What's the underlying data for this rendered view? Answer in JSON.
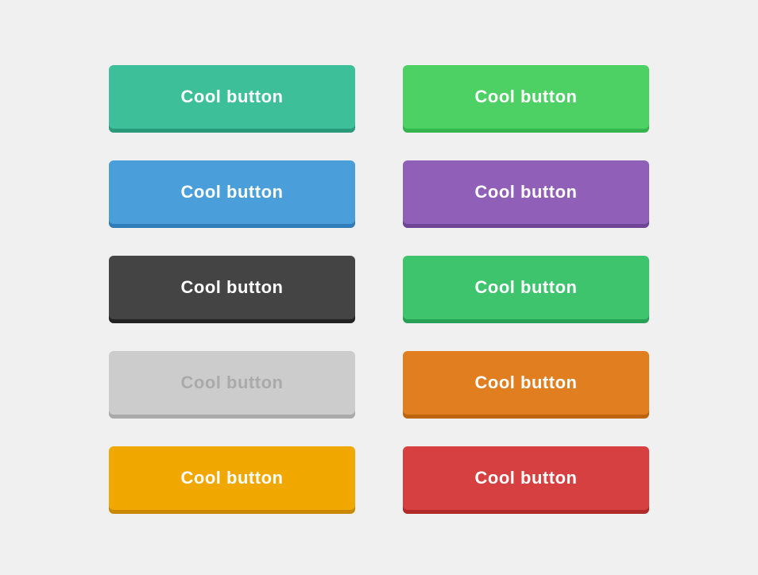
{
  "buttons": [
    {
      "id": "btn-1",
      "label": "Cool button",
      "class": "btn-teal",
      "name": "teal-button"
    },
    {
      "id": "btn-2",
      "label": "Cool button",
      "class": "btn-green",
      "name": "green-button"
    },
    {
      "id": "btn-3",
      "label": "Cool button",
      "class": "btn-blue",
      "name": "blue-button"
    },
    {
      "id": "btn-4",
      "label": "Cool button",
      "class": "btn-purple",
      "name": "purple-button"
    },
    {
      "id": "btn-5",
      "label": "Cool button",
      "class": "btn-dark",
      "name": "dark-button"
    },
    {
      "id": "btn-6",
      "label": "Cool button",
      "class": "btn-green2",
      "name": "green2-button"
    },
    {
      "id": "btn-7",
      "label": "Cool button",
      "class": "btn-lightgray",
      "name": "lightgray-button"
    },
    {
      "id": "btn-8",
      "label": "Cool button",
      "class": "btn-orange",
      "name": "orange-button"
    },
    {
      "id": "btn-9",
      "label": "Cool button",
      "class": "btn-yellow",
      "name": "yellow-button"
    },
    {
      "id": "btn-10",
      "label": "Cool button",
      "class": "btn-red",
      "name": "red-button"
    }
  ]
}
